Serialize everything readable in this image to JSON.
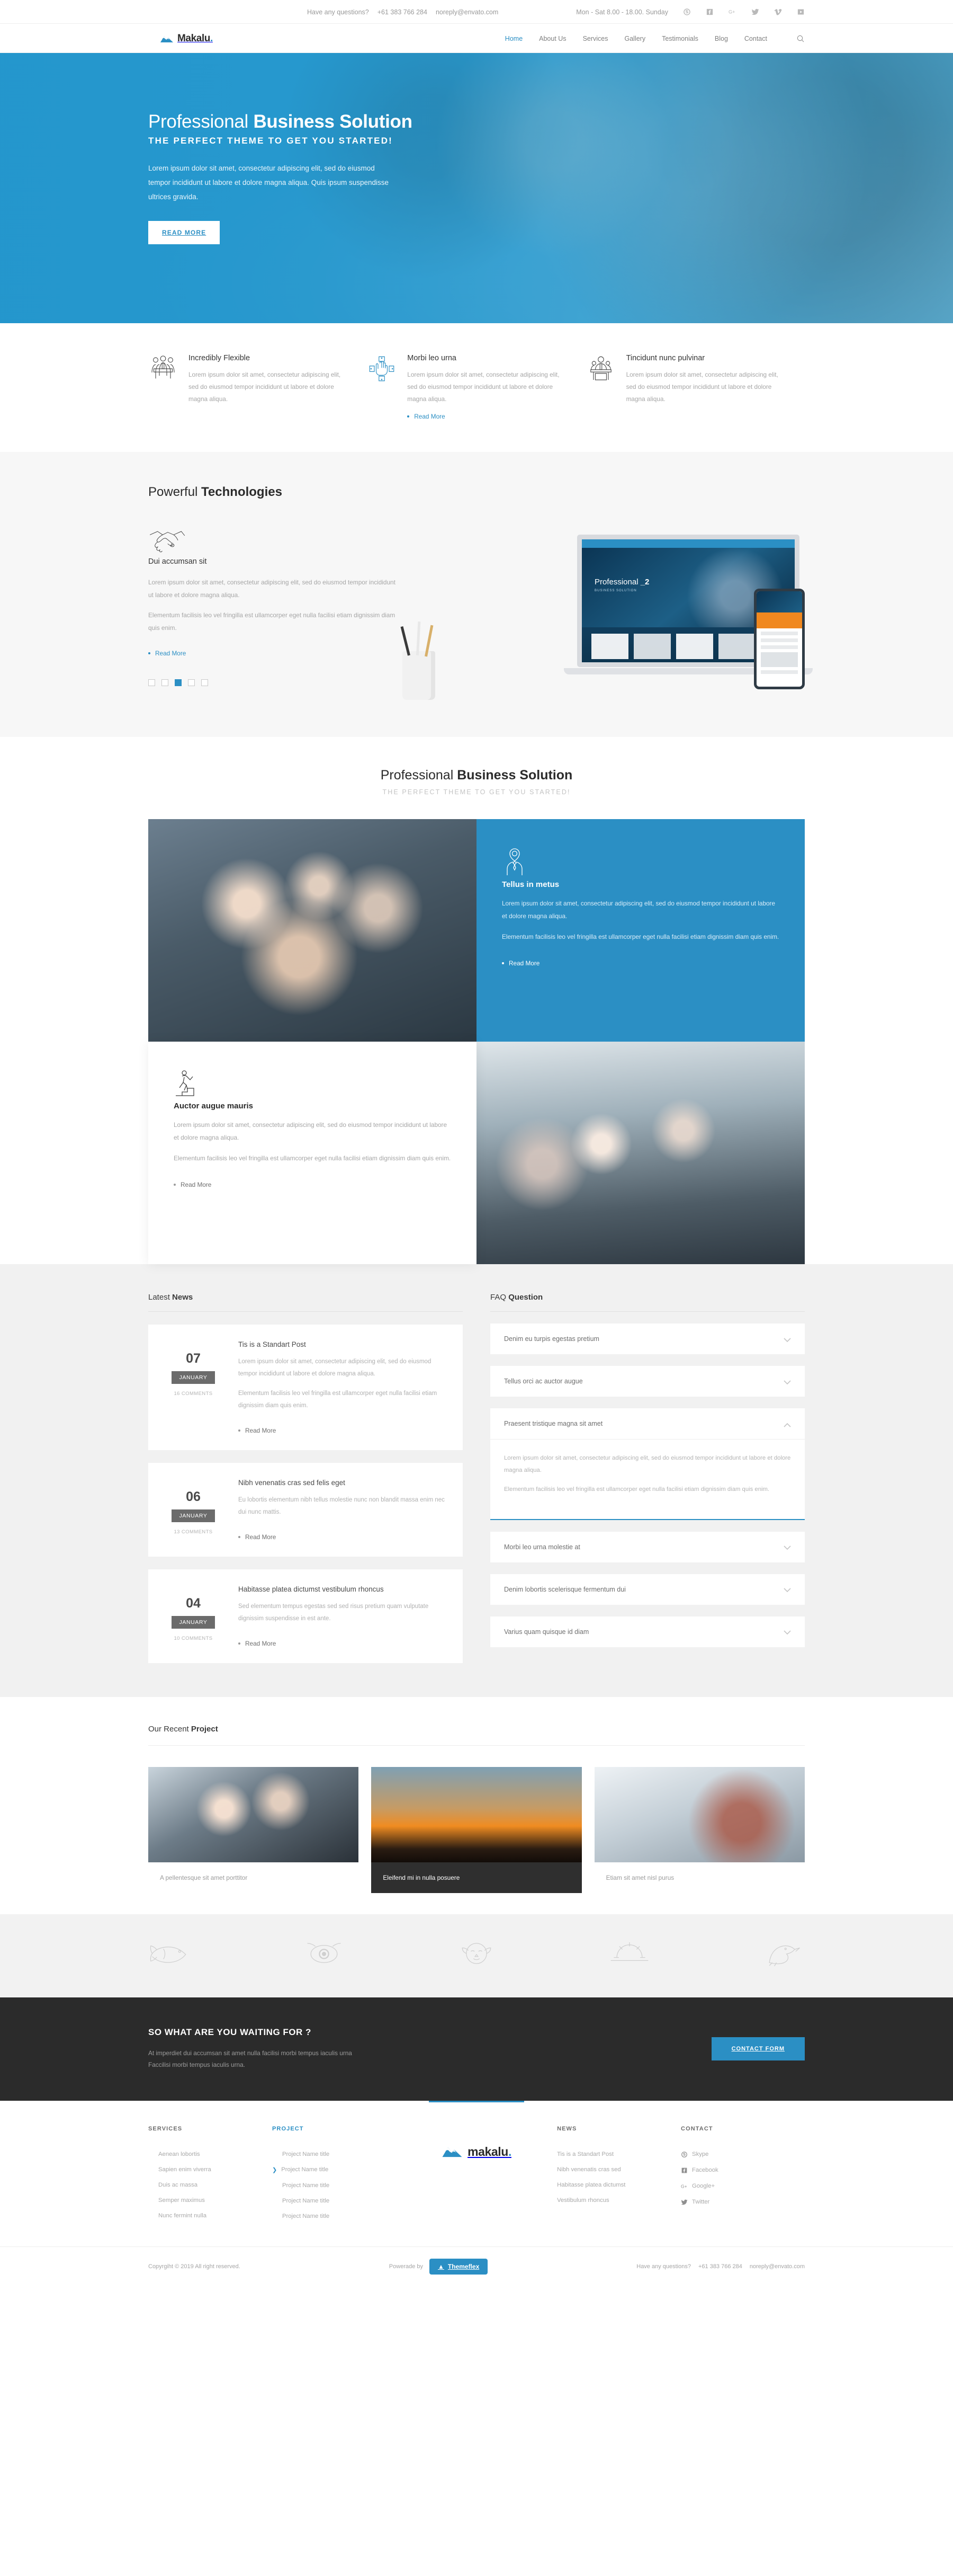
{
  "topbar": {
    "questions_label": "Have any questions?",
    "phone": "+61 383 766 284",
    "email": "noreply@envato.com",
    "hours": "Mon - Sat 8.00 - 18.00. Sunday",
    "social": [
      "skype-icon",
      "facebook-icon",
      "google-plus-icon",
      "twitter-icon",
      "vimeo-icon",
      "youtube-icon"
    ]
  },
  "header": {
    "logo_text": "Makalu",
    "logo_dot": ".",
    "nav": [
      {
        "label": "Home",
        "active": true
      },
      {
        "label": "About Us",
        "active": false
      },
      {
        "label": "Services",
        "active": false
      },
      {
        "label": "Gallery",
        "active": false
      },
      {
        "label": "Testimonials",
        "active": false
      },
      {
        "label": "Blog",
        "active": false
      },
      {
        "label": "Contact",
        "active": false
      }
    ],
    "search_icon": "search-icon"
  },
  "hero": {
    "title_light": "Professional ",
    "title_bold": "Business Solution",
    "subtitle": "THE PERFECT THEME TO GET YOU STARTED!",
    "paragraph": "Lorem ipsum dolor sit amet, consectetur adipiscing elit, sed do eiusmod tempor incididunt ut labore et dolore magna aliqua. Quis ipsum suspendisse ultrices gravida.",
    "button": "READ MORE"
  },
  "features": [
    {
      "icon": "meeting-table-icon",
      "title": "Incredibly Flexible",
      "text": "Lorem ipsum dolor sit amet, consectetur adipiscing elit, sed do eiusmod tempor incididunt ut labore et dolore magna aliqua.",
      "link": null
    },
    {
      "icon": "hands-together-icon",
      "title": "Morbi leo urna",
      "text": "Lorem ipsum dolor sit amet, consectetur adipiscing elit, sed do eiusmod tempor incididunt ut labore et dolore magna aliqua.",
      "link": "Read More"
    },
    {
      "icon": "presenter-desk-icon",
      "title": "Tincidunt nunc pulvinar",
      "text": "Lorem ipsum dolor sit amet, consectetur adipiscing elit, sed do eiusmod tempor incididunt ut labore et dolore magna aliqua.",
      "link": null
    }
  ],
  "tech": {
    "title_light": "Powerful ",
    "title_bold": "Technologies",
    "icon": "handshake-icon",
    "subtitle": "Dui accumsan sit",
    "paragraph1": "Lorem ipsum dolor sit amet, consectetur adipiscing elit, sed do eiusmod tempor incididunt ut labore et dolore magna aliqua.",
    "paragraph2": "Elementum facilisis leo vel fringilla est ullamcorper eget nulla facilisi etiam dignissim diam quis enim.",
    "link": "Read More",
    "dots_total": 5,
    "dots_active_index": 2,
    "device_screen": {
      "title_light": "Professional ",
      "title_bold": "_2",
      "subtitle": "BUSINESS SOLUTION"
    }
  },
  "pro": {
    "title_light": "Professional ",
    "title_bold": "Business Solution",
    "subtitle": "THE PERFECT THEME TO GET YOU STARTED!",
    "cards": [
      {
        "type": "image",
        "image": "team-hands-photo"
      },
      {
        "type": "blue",
        "icon": "person-tie-icon",
        "title": "Tellus in metus",
        "p1": "Lorem ipsum dolor sit amet, consectetur adipiscing elit, sed do eiusmod tempor incididunt ut labore et dolore magna aliqua.",
        "p2": "Elementum facilisis leo vel fringilla est ullamcorper eget nulla facilisi etiam dignissim diam quis enim.",
        "link": "Read More"
      },
      {
        "type": "white",
        "icon": "person-stairs-icon",
        "title": "Auctor augue mauris",
        "p1": "Lorem ipsum dolor sit amet, consectetur adipiscing elit, sed do eiusmod tempor incididunt ut labore et dolore magna aliqua.",
        "p2": "Elementum facilisis leo vel fringilla est ullamcorper eget nulla facilisi etiam dignissim diam quis enim.",
        "link": "Read More"
      },
      {
        "type": "image",
        "image": "boardroom-meeting-photo"
      }
    ]
  },
  "news": {
    "title_light": "Latest ",
    "title_bold": "News",
    "posts": [
      {
        "day": "07",
        "month": "JANUARY",
        "comments": "16 COMMENTS",
        "title": "Tis is a Standart Post",
        "p1": "Lorem ipsum dolor sit amet, consectetur adipiscing elit, sed do eiusmod tempor incididunt ut labore et dolore magna aliqua.",
        "p2": "Elementum facilisis leo vel fringilla est ullamcorper eget nulla facilisi etiam dignissim diam quis enim.",
        "link": "Read More"
      },
      {
        "day": "06",
        "month": "JANUARY",
        "comments": "13 COMMENTS",
        "title": "Nibh venenatis cras sed felis eget",
        "p1": "Eu lobortis elementum nibh tellus molestie nunc non blandit massa enim nec dui nunc mattis.",
        "p2": null,
        "link": "Read More"
      },
      {
        "day": "04",
        "month": "JANUARY",
        "comments": "10 COMMENTS",
        "title": "Habitasse platea dictumst vestibulum rhoncus",
        "p1": "Sed elementum tempus egestas sed sed risus pretium quam vulputate dignissim suspendisse in est ante.",
        "p2": null,
        "link": "Read More"
      }
    ]
  },
  "faq": {
    "title_light": "FAQ ",
    "title_bold": "Question",
    "items": [
      {
        "q": "Denim eu turpis egestas pretium",
        "open": false,
        "a1": null,
        "a2": null
      },
      {
        "q": "Tellus orci ac auctor augue",
        "open": false,
        "a1": null,
        "a2": null
      },
      {
        "q": "Praesent tristique magna sit amet",
        "open": true,
        "a1": "Lorem ipsum dolor sit amet, consectetur adipiscing elit, sed do eiusmod tempor incididunt ut labore et dolore magna aliqua.",
        "a2": "Elementum facilisis leo vel fringilla est ullamcorper eget nulla facilisi etiam dignissim diam quis enim."
      },
      {
        "q": "Morbi leo urna molestie at",
        "open": false,
        "a1": null,
        "a2": null
      },
      {
        "q": "Denim lobortis scelerisque fermentum dui",
        "open": false,
        "a1": null,
        "a2": null
      },
      {
        "q": "Varius quam quisque id diam",
        "open": false,
        "a1": null,
        "a2": null
      }
    ]
  },
  "projects": {
    "title_light": "Our Recent ",
    "title_bold": "Project",
    "items": [
      {
        "caption": "A pellentesque sit amet porttitor",
        "highlight": false,
        "image": "office-desk-photo"
      },
      {
        "caption": "Eleifend mi in nulla posuere",
        "highlight": true,
        "image": "construction-sunset-photo"
      },
      {
        "caption": "Etiam sit amet nisl purus",
        "highlight": false,
        "image": "laptop-hands-photo"
      }
    ]
  },
  "clients": [
    "fish-logo-icon",
    "eye-target-logo-icon",
    "lion-head-logo-icon",
    "sunrise-logo-icon",
    "bird-logo-icon"
  ],
  "cta": {
    "heading": "SO WHAT ARE YOU WAITING FOR ?",
    "text": "At imperdiet dui accumsan sit amet nulla facilisi morbi tempus iaculis urna Faccilisi morbi tempus iaculis urna.",
    "button": "CONTACT FORM"
  },
  "footer": {
    "services": {
      "heading": "SERVICES",
      "items": [
        "Aenean lobortis",
        "Sapien enim viverra",
        "Duis ac massa",
        "Semper maximus",
        "Nunc fermint nulla"
      ]
    },
    "project": {
      "heading": "PROJECT",
      "active_index": 1,
      "items": [
        "Project Name title",
        "Project Name title",
        "Project Name title",
        "Project Name title",
        "Project Name title"
      ]
    },
    "logo_text": "makalu",
    "logo_dot": ".",
    "news": {
      "heading": "NEWS",
      "items": [
        "Tis is a Standart Post",
        "Nibh venenatis cras sed",
        "Habitasse platea dictumst",
        "Vestibulum rhoncus"
      ]
    },
    "contact": {
      "heading": "CONTACT",
      "items": [
        {
          "icon": "skype-icon",
          "label": "Skype"
        },
        {
          "icon": "facebook-icon",
          "label": "Facebook"
        },
        {
          "icon": "google-plus-icon",
          "label": "Google+"
        },
        {
          "icon": "twitter-icon",
          "label": "Twitter"
        }
      ]
    },
    "copyright": "Copyrgiht © 2019 All right reserved.",
    "powered_label": "Powerade by",
    "powered_brand": "Themeflex",
    "questions_label": "Have any questions?",
    "phone": "+61 383 766 284",
    "email": "noreply@envato.com"
  },
  "colors": {
    "accent": "#2b8fc4",
    "dark": "#2b2b2b",
    "muted": "#a6a6a6"
  }
}
